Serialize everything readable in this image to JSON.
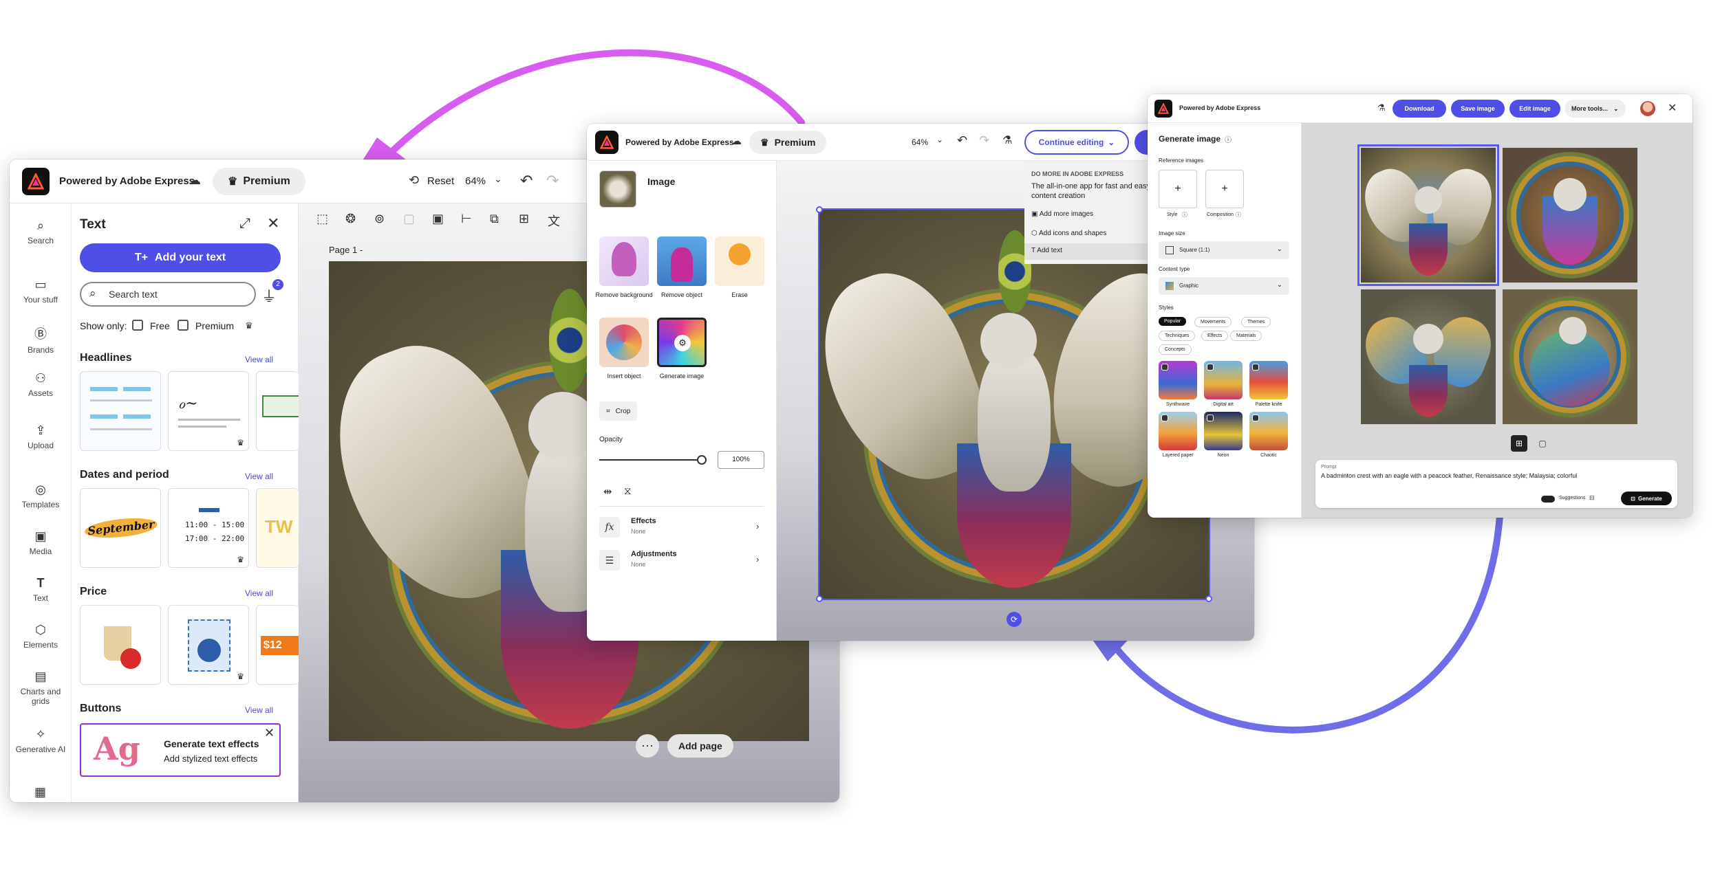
{
  "arrows": {
    "top_color": "#d85cf0",
    "bottom_color": "#6f6ee8"
  },
  "win1": {
    "brand": "Powered by Adobe Express",
    "premium": "Premium",
    "reset": "Reset",
    "zoom": "64%",
    "sidebar": [
      {
        "label": "Search",
        "icon": "search-icon"
      },
      {
        "label": "Your stuff",
        "icon": "folder-icon"
      },
      {
        "label": "Brands",
        "icon": "brand-icon"
      },
      {
        "label": "Assets",
        "icon": "assets-icon"
      },
      {
        "label": "Upload",
        "icon": "upload-icon"
      },
      {
        "label": "Templates",
        "icon": "templates-icon"
      },
      {
        "label": "Media",
        "icon": "media-icon"
      },
      {
        "label": "Text",
        "icon": "text-icon"
      },
      {
        "label": "Elements",
        "icon": "elements-icon"
      },
      {
        "label": "Charts and grids",
        "icon": "charts-icon"
      },
      {
        "label": "Generative AI",
        "icon": "generative-ai-icon"
      }
    ],
    "panel": {
      "title": "Text",
      "add_text": "Add your text",
      "search_placeholder": "Search text",
      "filter_badge": "2",
      "show_only": "Show only:",
      "free": "Free",
      "premium": "Premium",
      "view_all": "View all",
      "sections": [
        "Headlines",
        "Dates and period",
        "Price",
        "Buttons"
      ],
      "date_tile_text": "September",
      "date_times": [
        "11:00 - 15:00",
        "17:00 - 22:00"
      ],
      "price_tag": "$12",
      "gen_title": "Generate text effects",
      "gen_sub": "Add stylized text effects",
      "gen_ag": "Ag"
    },
    "page_label": "Page 1 -",
    "add_page": "Add page"
  },
  "win2": {
    "brand": "Powered by Adobe Express",
    "premium": "Premium",
    "zoom": "64%",
    "continue": "Continue editing",
    "panel_title": "Image",
    "tools": [
      "Remove background",
      "Remove object",
      "Erase",
      "Insert object",
      "Generate image"
    ],
    "crop": "Crop",
    "opacity": "Opacity",
    "opacity_value": "100%",
    "opacity_fraction": 1.0,
    "effects": "Effects",
    "effects_sub": "None",
    "adjustments": "Adjustments",
    "adjustments_sub": "None",
    "promo_heading": "DO MORE IN ADOBE EXPRESS",
    "promo_text": "The all-in-one app for fast and easy content creation",
    "promo_items": [
      "Add more images",
      "Add icons and shapes",
      "Add text"
    ]
  },
  "win3": {
    "brand": "Powered by Adobe Express",
    "download": "Download",
    "save": "Save image",
    "edit": "Edit image",
    "more": "More tools...",
    "title": "Generate image",
    "ref_label": "Reference images",
    "ref_items": [
      "Style",
      "Composition"
    ],
    "size_label": "Image size",
    "size_value": "Square (1:1)",
    "content_label": "Content type",
    "content_value": "Graphic",
    "styles_label": "Styles",
    "style_tabs": [
      "Popular",
      "Movements",
      "Themes",
      "Techniques",
      "Effects",
      "Materials",
      "Concepts"
    ],
    "style_tiles": [
      "Synthwave",
      "Digital art",
      "Palette knife",
      "Layered paper",
      "Neon",
      "Chaotic"
    ],
    "prompt_label": "Prompt",
    "prompt_text": "A badminton crest with an eagle with a peacock feather, Renaissance style; Malaysia; colorful",
    "suggestions": "Suggestions",
    "generate": "Generate"
  }
}
